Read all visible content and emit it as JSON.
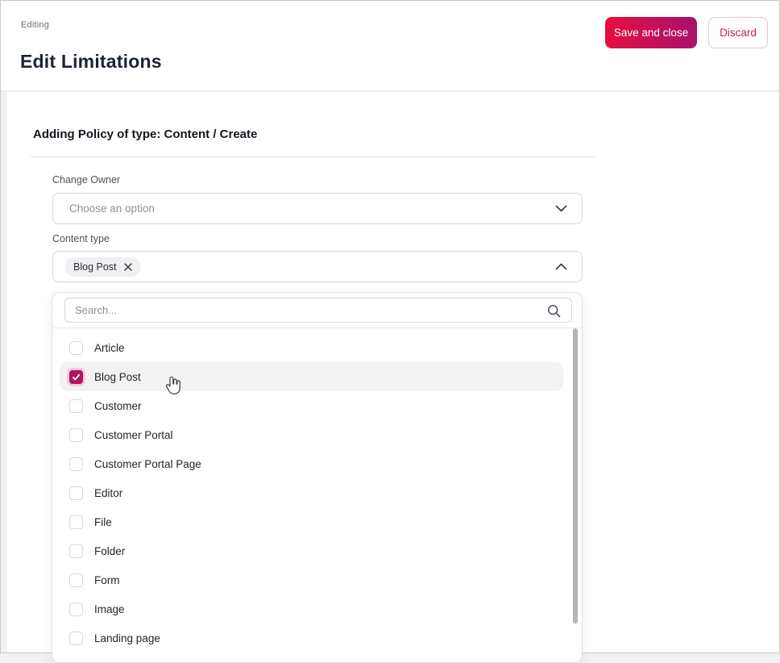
{
  "header": {
    "eyebrow": "Editing",
    "title": "Edit Limitations",
    "save_label": "Save and close",
    "discard_label": "Discard"
  },
  "form": {
    "section_title": "Adding Policy of type: Content / Create",
    "change_owner": {
      "label": "Change Owner",
      "placeholder": "Choose an option"
    },
    "content_type": {
      "label": "Content type",
      "selected_chip": "Blog Post"
    }
  },
  "dropdown": {
    "search_placeholder": "Search...",
    "options": [
      {
        "label": "Article",
        "checked": false,
        "highlighted": false
      },
      {
        "label": "Blog Post",
        "checked": true,
        "highlighted": true
      },
      {
        "label": "Customer",
        "checked": false,
        "highlighted": false
      },
      {
        "label": "Customer Portal",
        "checked": false,
        "highlighted": false
      },
      {
        "label": "Customer Portal Page",
        "checked": false,
        "highlighted": false
      },
      {
        "label": "Editor",
        "checked": false,
        "highlighted": false
      },
      {
        "label": "File",
        "checked": false,
        "highlighted": false
      },
      {
        "label": "Folder",
        "checked": false,
        "highlighted": false
      },
      {
        "label": "Form",
        "checked": false,
        "highlighted": false
      },
      {
        "label": "Image",
        "checked": false,
        "highlighted": false
      },
      {
        "label": "Landing page",
        "checked": false,
        "highlighted": false
      }
    ]
  },
  "icons": {
    "chevron_down": "chevron-down-icon",
    "chevron_up": "chevron-up-icon",
    "close_x": "close-icon",
    "search": "search-icon",
    "checkmark": "checkmark-icon",
    "hand_cursor": "hand-pointer-cursor-icon"
  },
  "colors": {
    "primary_gradient_start": "#e60f3f",
    "primary_gradient_end": "#a8106f",
    "secondary_text": "#c41e63",
    "secondary_border": "#f5bcd4",
    "checkbox_checked": "#b4125f",
    "checkbox_ring": "#f2cbdd",
    "row_highlight": "#f2f2f2",
    "title_text": "#1c2431",
    "scroll_thumb": "#b5b5b5"
  }
}
